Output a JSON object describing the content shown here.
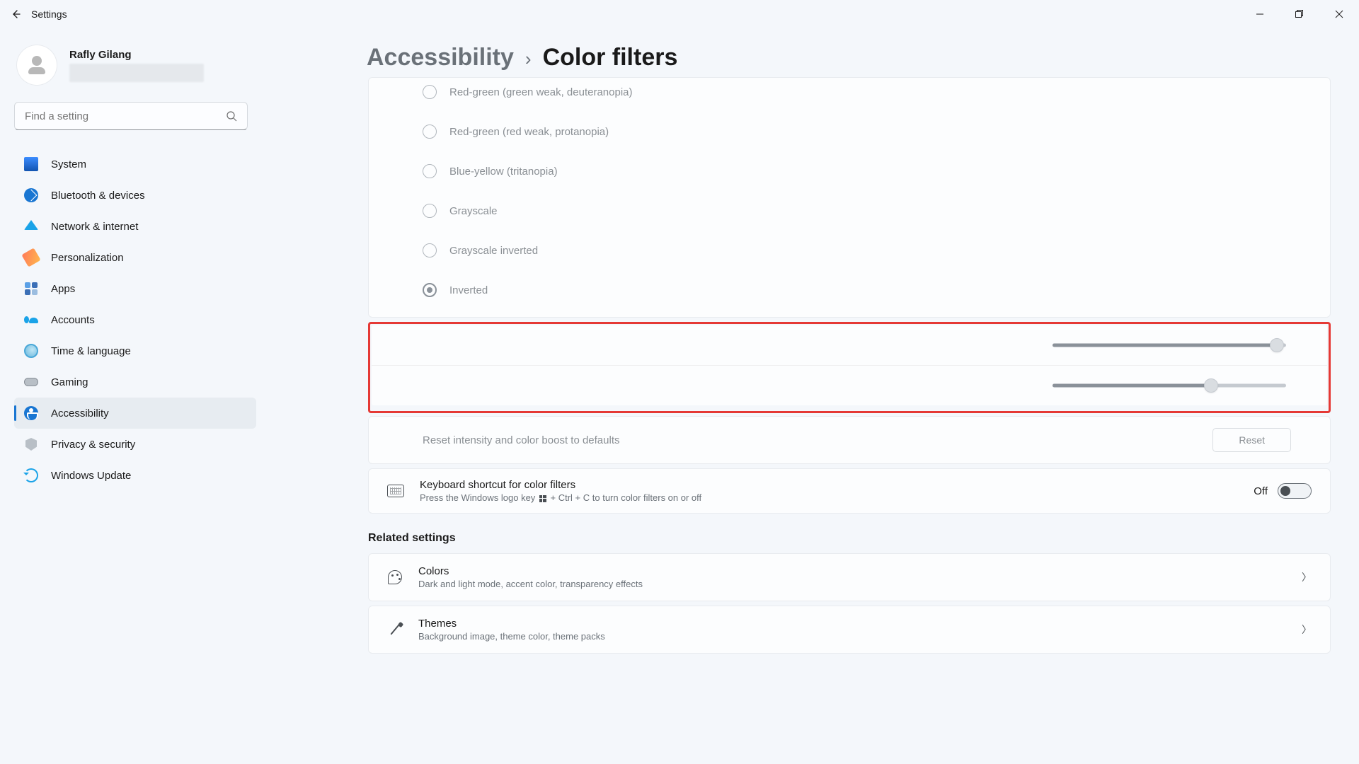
{
  "window": {
    "title": "Settings"
  },
  "user": {
    "name": "Rafly Gilang"
  },
  "search": {
    "placeholder": "Find a setting"
  },
  "nav": {
    "system": "System",
    "bluetooth": "Bluetooth & devices",
    "network": "Network & internet",
    "personalization": "Personalization",
    "apps": "Apps",
    "accounts": "Accounts",
    "time": "Time & language",
    "gaming": "Gaming",
    "accessibility": "Accessibility",
    "privacy": "Privacy & security",
    "update": "Windows Update"
  },
  "crumb": {
    "parent": "Accessibility",
    "sep": "›",
    "current": "Color filters"
  },
  "filters": {
    "deuteranopia": "Red-green (green weak, deuteranopia)",
    "protanopia": "Red-green (red weak, protanopia)",
    "tritanopia": "Blue-yellow (tritanopia)",
    "grayscale": "Grayscale",
    "grayscale_inv": "Grayscale inverted",
    "inverted": "Inverted"
  },
  "sliders": {
    "intensity_pct": 96,
    "boost_pct": 68
  },
  "reset": {
    "label": "Reset intensity and color boost to defaults",
    "button": "Reset"
  },
  "shortcut": {
    "title": "Keyboard shortcut for color filters",
    "sub_prefix": "Press the Windows logo key ",
    "sub_suffix": " + Ctrl + C to turn color filters on or off",
    "state": "Off"
  },
  "related": {
    "heading": "Related settings",
    "colors": {
      "title": "Colors",
      "sub": "Dark and light mode, accent color, transparency effects"
    },
    "themes": {
      "title": "Themes",
      "sub": "Background image, theme color, theme packs"
    }
  }
}
